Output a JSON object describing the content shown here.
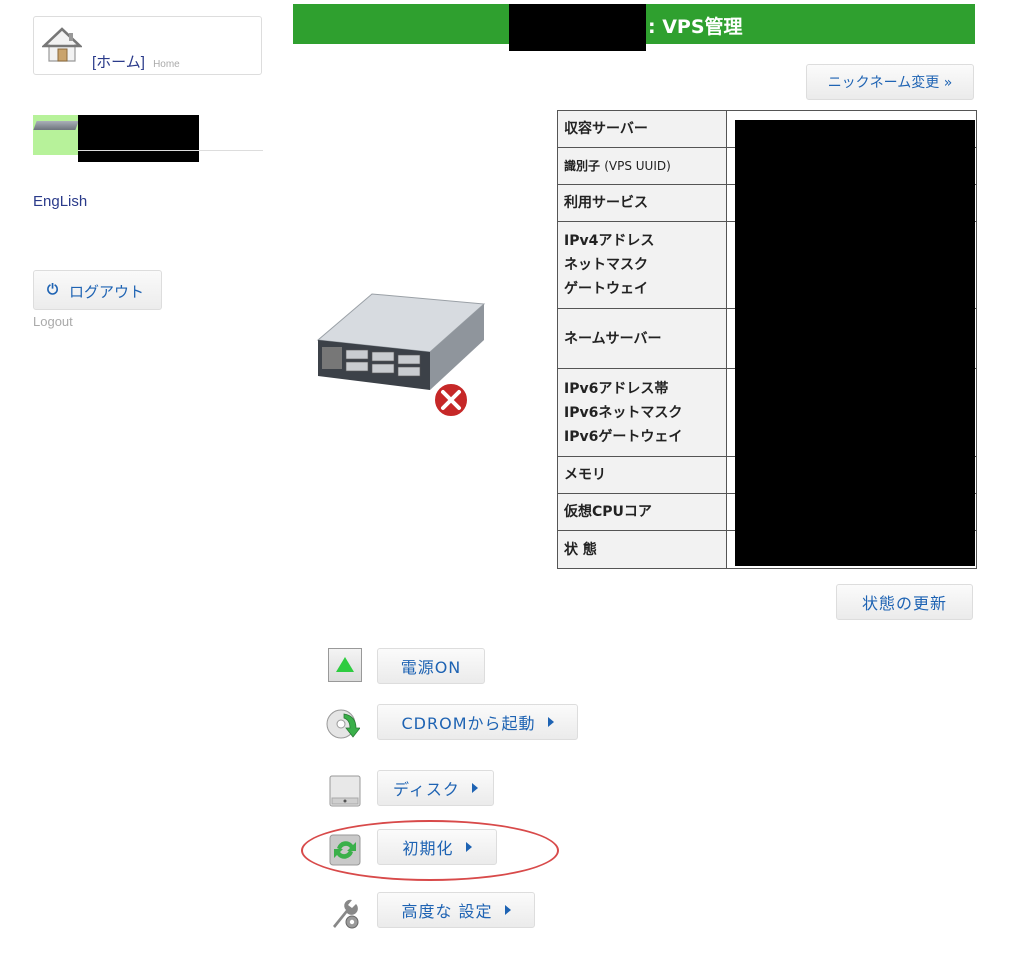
{
  "sidebar": {
    "home_label": "[ホーム]",
    "home_sub": "Home",
    "language_link": "EngLish",
    "logout_label": "ログアウト",
    "logout_sub": "Logout"
  },
  "header": {
    "title": ": VPS管理"
  },
  "buttons": {
    "nickname": "ニックネーム変更 »",
    "refresh": "状態の更新"
  },
  "info_table": {
    "rows": [
      "収容サーバー",
      "識別子",
      "利用サービス",
      "IPv4アドレス",
      "ネットマスク",
      "ゲートウェイ",
      "ネームサーバー",
      "IPv6アドレス帯",
      "IPv6ネットマスク",
      "IPv6ゲートウェイ",
      "メモリ",
      "仮想CPUコア",
      "状 態"
    ],
    "uuid_suffix": "(VPS UUID)"
  },
  "actions": {
    "power_on": "電源ON",
    "cdrom_boot": "CDROMから起動",
    "disk": "ディスク",
    "initialize": "初期化",
    "advanced": "高度な 設定"
  },
  "colors": {
    "header_green": "#2fa02f",
    "link_blue": "#1e63b3",
    "highlight_red": "#d84a4a"
  }
}
